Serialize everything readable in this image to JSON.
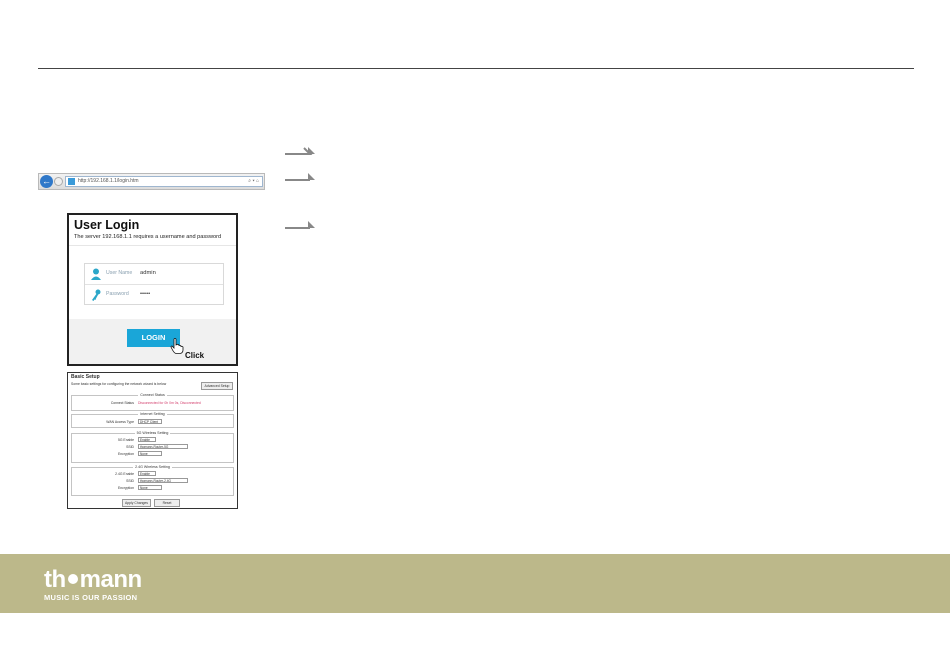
{
  "browser": {
    "url": "http://192.168.1.1/login.htm",
    "tools": "⌕ ▾ ⌂",
    "back_icon": "arrow-left-icon"
  },
  "login": {
    "title": "User Login",
    "subtitle": "The server 192.168.1.1 requires a username and password",
    "username_label": "User Name",
    "username_value": "admin",
    "password_label": "Password",
    "password_value": "•••••",
    "button_label": "LOGIN",
    "click_label": "Click",
    "button_color": "#1aa6d8"
  },
  "setup": {
    "title": "Basic Setup",
    "description": "Some basic settings for configuring the network wizard is below",
    "advanced_button": "Advanced Setup",
    "connect_status": {
      "header": "Connect Status",
      "label": "Connect Status",
      "value": "Disconnected for 0h 0m 0s, Disconnected"
    },
    "internet": {
      "header": "Internet Setting",
      "label": "WAN Access Type",
      "value": "DHCP Client"
    },
    "wireless_5g": {
      "header": "5G Wireless Setting",
      "rows": [
        {
          "label": "5G Enable",
          "value": "Enable"
        },
        {
          "label": "SSID",
          "value": "thomann-Router-5G"
        },
        {
          "label": "Encryption",
          "value": "None"
        }
      ]
    },
    "wireless_24g": {
      "header": "2.4G Wireless Setting",
      "rows": [
        {
          "label": "2.4G Enable",
          "value": "Enable"
        },
        {
          "label": "SSID",
          "value": "thomann-Router-2.4G"
        },
        {
          "label": "Encryption",
          "value": "None"
        }
      ]
    },
    "apply_button": "Apply Changes",
    "reset_button": "Reset"
  },
  "brand": {
    "logo_left": "th",
    "logo_right": "mann",
    "tagline": "MUSIC IS OUR PASSION",
    "bar_color": "#bcb88a"
  }
}
